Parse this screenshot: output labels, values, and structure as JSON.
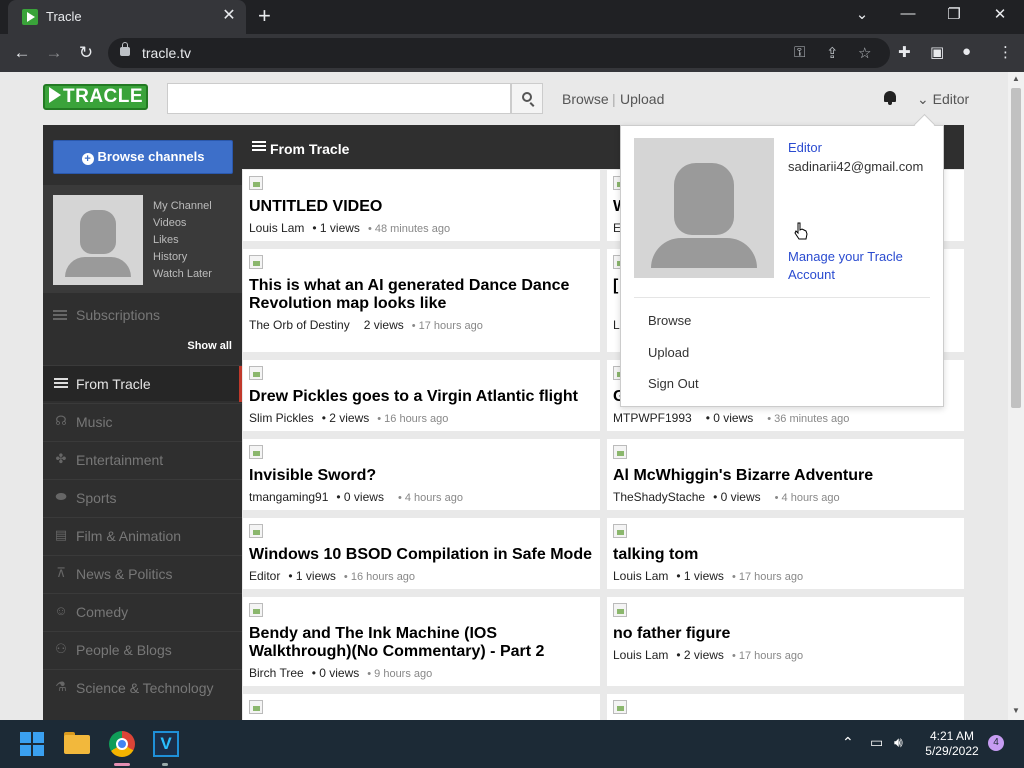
{
  "browser": {
    "tab_title": "Tracle",
    "tab_close": "✕",
    "new_tab": "+",
    "window_controls": {
      "minimize": "—",
      "maximize": "❐",
      "close": "✕",
      "tab_search": "⌄"
    },
    "url": "tracle.tv"
  },
  "site": {
    "logo": "TRACLE",
    "search": {
      "value": "",
      "placeholder": ""
    },
    "nav": {
      "browse": "Browse",
      "separator": "|",
      "upload": "Upload"
    },
    "user_menu_label": "Editor"
  },
  "sidebar": {
    "browse_channels": "Browse channels",
    "profile_links": [
      "My Channel",
      "Videos",
      "Likes",
      "History",
      "Watch Later"
    ],
    "subscriptions": "Subscriptions",
    "show_all": "Show all",
    "categories": [
      {
        "label": "From Tracle",
        "icon": "list-icon",
        "active": true
      },
      {
        "label": "Music",
        "icon": "headphones-icon",
        "active": false
      },
      {
        "label": "Entertainment",
        "icon": "gamepad-icon",
        "active": false
      },
      {
        "label": "Sports",
        "icon": "football-icon",
        "active": false
      },
      {
        "label": "Film & Animation",
        "icon": "film-icon",
        "active": false
      },
      {
        "label": "News & Politics",
        "icon": "broadcast-icon",
        "active": false
      },
      {
        "label": "Comedy",
        "icon": "mask-icon",
        "active": false
      },
      {
        "label": "People & Blogs",
        "icon": "users-icon",
        "active": false
      },
      {
        "label": "Science & Technology",
        "icon": "flask-icon",
        "active": false
      }
    ]
  },
  "feed": {
    "title": "From Tracle",
    "videos": [
      {
        "title": "UNTITLED VIDEO",
        "author": "Louis Lam",
        "views": "• 1 views",
        "ago": "•   48 minutes ago"
      },
      {
        "title": "W",
        "author": "E",
        "views": "",
        "ago": ""
      },
      {
        "title": "This is what an AI generated Dance Dance Revolution map looks like",
        "author": "The Orb of Destiny",
        "views": "2 views",
        "ago": "•   17 hours ago"
      },
      {
        "title": "[",
        "author": "L",
        "views": "",
        "ago": ""
      },
      {
        "title": "Drew Pickles goes to a Virgin Atlantic flight",
        "author": "Slim Pickles",
        "views": "•   2 views",
        "ago": "•   16 hours ago"
      },
      {
        "title": "G",
        "author": "MTPWPF1993",
        "views": "• 0 views",
        "ago": "•   36 minutes ago"
      },
      {
        "title": "Invisible Sword?",
        "author": "tmangaming91",
        "views": "• 0 views",
        "ago": "•   4 hours ago"
      },
      {
        "title": "Al McWhiggin's Bizarre Adventure",
        "author": "TheShadyStache",
        "views": "• 0 views",
        "ago": "•   4 hours ago"
      },
      {
        "title": "Windows 10 BSOD Compilation in Safe Mode",
        "author": "Editor",
        "views": "•   1 views",
        "ago": "•   16 hours ago"
      },
      {
        "title": "talking tom",
        "author": "Louis Lam",
        "views": "• 1 views",
        "ago": "•   17 hours ago"
      },
      {
        "title": "Bendy and The Ink Machine (IOS Walkthrough)(No Commentary) - Part 2",
        "author": "Birch Tree",
        "views": "•   0 views",
        "ago": "•   9 hours ago"
      },
      {
        "title": "no father figure",
        "author": "Louis Lam",
        "views": "• 2 views",
        "ago": "•   17 hours ago"
      }
    ]
  },
  "dropdown": {
    "name": "Editor",
    "email": "sadinarii42@gmail.com",
    "manage": "Manage your Tracle Account",
    "items": [
      "Browse",
      "Upload",
      "Sign Out"
    ]
  },
  "taskbar": {
    "clock_time": "4:21 AM",
    "clock_date": "5/29/2022",
    "notifications": "4"
  }
}
